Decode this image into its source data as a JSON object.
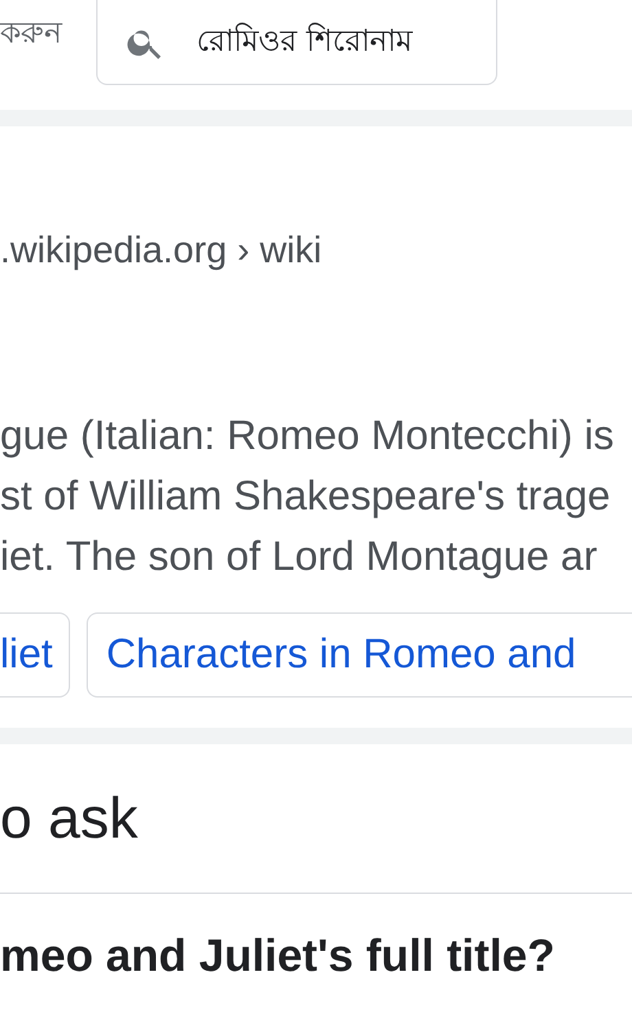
{
  "search_bar": {
    "left_label": "করুন",
    "query": "রোমিওর শিরোনাম"
  },
  "result": {
    "breadcrumb": ".wikipedia.org › wiki",
    "snippet_lines": [
      "gue (Italian: Romeo Montecchi) is",
      "st of William Shakespeare's trage",
      "iet. The son of Lord Montague ar"
    ],
    "chips": [
      "liet",
      "Characters in Romeo and"
    ]
  },
  "related_questions": {
    "heading": "o ask",
    "questions": [
      "meo and Juliet's full title?"
    ]
  }
}
